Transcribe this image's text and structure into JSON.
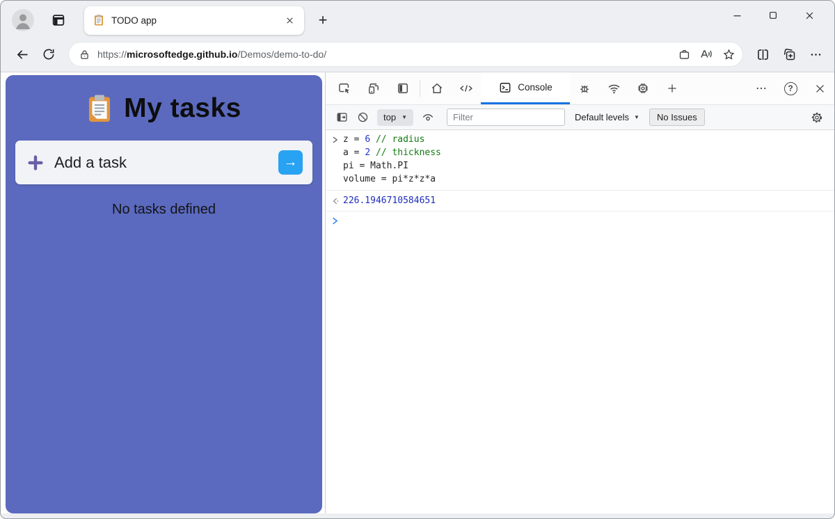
{
  "theme": {
    "chrome_bg": "#edeff2",
    "todo_bg": "#5b6abe",
    "card_bg": "#f1f3f6",
    "plus_color": "#665fa7",
    "submit_bg": "#28a2f2",
    "accent_blue": "#1673e1",
    "number_color": "#2433d0",
    "comment_color": "#127a12",
    "result_color": "#1f2db8",
    "prompt_color": "#2e7df6"
  },
  "browser": {
    "tab": {
      "title": "TODO app"
    },
    "address": {
      "scheme": "https://",
      "host": "microsoftedge.github.io",
      "path": "/Demos/demo-to-do/"
    }
  },
  "glyphs": {
    "new_tab": "+",
    "ellipsis_vert": "⋯",
    "code_tab": "</>",
    "caret_down": "▼",
    "help": "?",
    "submit_arrow": "→"
  },
  "page": {
    "title": "My tasks",
    "add_task_placeholder": "Add a task",
    "empty_message": "No tasks defined"
  },
  "devtools": {
    "tabs": {
      "console_label": "Console"
    },
    "toolbar": {
      "context_selector": "top",
      "filter_placeholder": "Filter",
      "levels_label": "Default levels",
      "issues_label": "No Issues"
    },
    "console": {
      "input_lines": [
        {
          "tokens": [
            {
              "type": "plain",
              "text": "z = "
            },
            {
              "type": "number",
              "text": "6"
            },
            {
              "type": "plain",
              "text": " "
            },
            {
              "type": "comment",
              "text": "// radius"
            }
          ]
        },
        {
          "tokens": [
            {
              "type": "plain",
              "text": "a = "
            },
            {
              "type": "number",
              "text": "2"
            },
            {
              "type": "plain",
              "text": " "
            },
            {
              "type": "comment",
              "text": "// thickness"
            }
          ]
        },
        {
          "tokens": [
            {
              "type": "plain",
              "text": "pi = Math.PI"
            }
          ]
        },
        {
          "tokens": [
            {
              "type": "plain",
              "text": "volume = pi*z*z*a"
            }
          ]
        }
      ],
      "result_value": "226.1946710584651"
    }
  }
}
